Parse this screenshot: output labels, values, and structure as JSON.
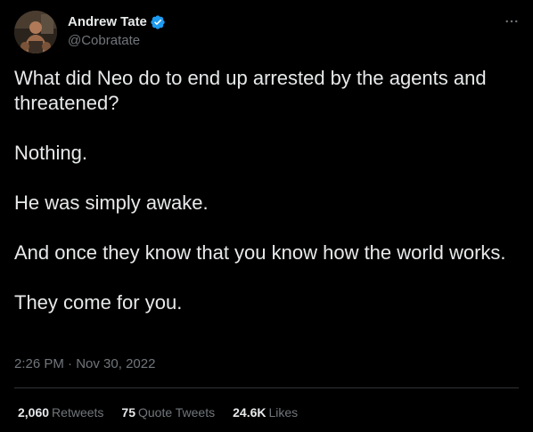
{
  "author": {
    "display_name": "Andrew Tate",
    "handle": "@Cobratate",
    "verified_icon": "verified-badge-icon"
  },
  "tweet": {
    "paragraphs": [
      "What did Neo do to end up arrested by the agents and threatened?",
      "Nothing.",
      "He was simply awake.",
      "And once they know that you know how the world works.",
      "They come for you."
    ],
    "time": "2:26 PM",
    "separator": " · ",
    "date": "Nov 30, 2022"
  },
  "stats": {
    "retweets": {
      "count": "2,060",
      "label": "Retweets"
    },
    "quote_tweets": {
      "count": "75",
      "label": "Quote Tweets"
    },
    "likes": {
      "count": "24.6K",
      "label": "Likes"
    }
  },
  "colors": {
    "background": "#000000",
    "text_primary": "#e7e9ea",
    "text_secondary": "#71767b",
    "divider": "#2f3336",
    "verified": "#1d9bf0"
  },
  "icons": {
    "more": "more-options-icon"
  }
}
